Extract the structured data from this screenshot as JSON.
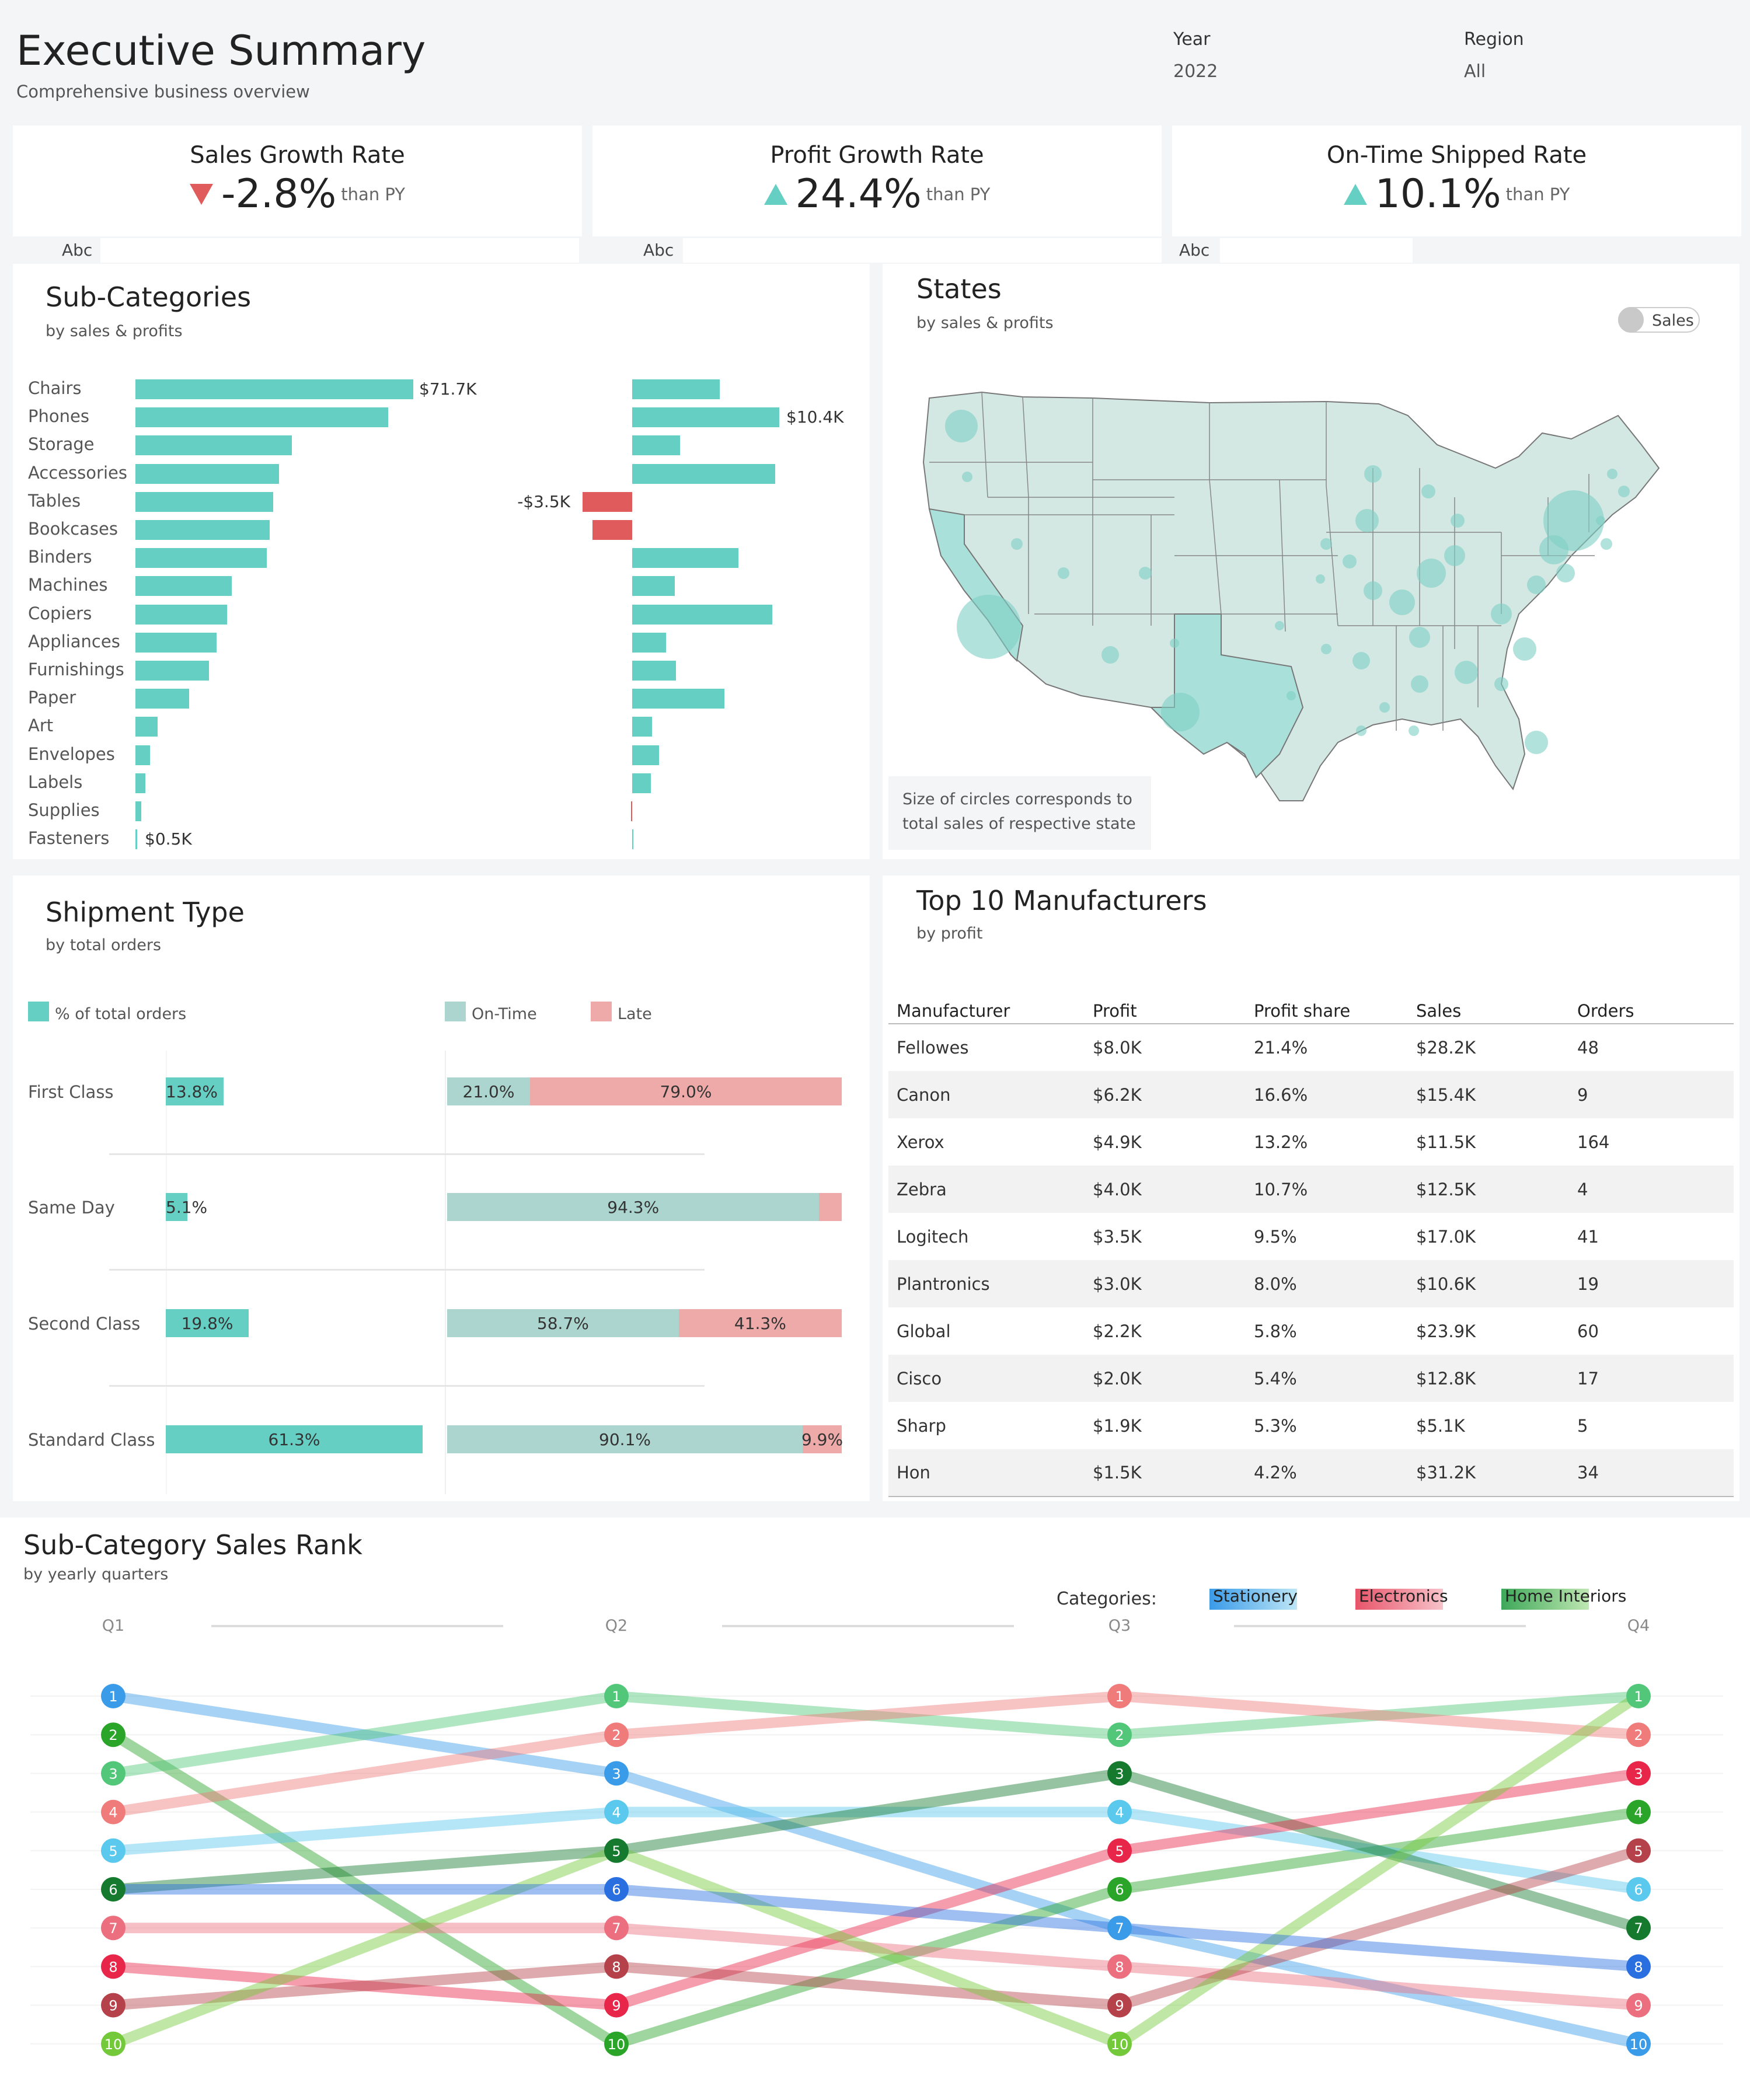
{
  "header": {
    "title": "Executive Summary",
    "subtitle": "Comprehensive business overview",
    "filters": [
      {
        "label": "Year",
        "value": "2022"
      },
      {
        "label": "Region",
        "value": "All"
      }
    ]
  },
  "kpis": [
    {
      "title": "Sales Growth Rate",
      "value": "-2.8%",
      "suffix": "than PY",
      "direction": "down",
      "placeholder": "Abc"
    },
    {
      "title": "Profit Growth Rate",
      "value": "24.4%",
      "suffix": "than PY",
      "direction": "up",
      "placeholder": "Abc"
    },
    {
      "title": "On-Time Shipped Rate",
      "value": "10.1%",
      "suffix": "than PY",
      "direction": "up",
      "placeholder": "Abc"
    }
  ],
  "colors": {
    "teal": "#66cfc4",
    "red": "#e05c5c",
    "late": "#eea9a9",
    "ontime": "#add5cf",
    "map_fill": "#d3e8e3",
    "map_highlight": "#a9e0d9"
  },
  "subcategories": {
    "title": "Sub-Categories",
    "subtitle": "by sales & profits",
    "sales_label_top": "$71.7K",
    "sales_label_bottom": "$0.5K",
    "profit_label_top": "$10.4K",
    "profit_label_neg": "-$3.5K",
    "chart_data": {
      "type": "bar",
      "categories": [
        "Chairs",
        "Phones",
        "Storage",
        "Accessories",
        "Tables",
        "Bookcases",
        "Binders",
        "Machines",
        "Copiers",
        "Appliances",
        "Furnishings",
        "Paper",
        "Art",
        "Envelopes",
        "Labels",
        "Supplies",
        "Fasteners"
      ],
      "series": [
        {
          "name": "Sales",
          "values": [
            71.7,
            65.2,
            40.4,
            37.0,
            35.6,
            34.7,
            33.9,
            24.9,
            23.7,
            21.0,
            19.0,
            13.9,
            5.7,
            3.8,
            2.6,
            1.5,
            0.5
          ]
        },
        {
          "name": "Profit",
          "values": [
            6.2,
            10.4,
            3.4,
            10.1,
            -3.5,
            -2.8,
            7.5,
            3.0,
            9.9,
            2.4,
            3.1,
            6.5,
            1.4,
            1.9,
            1.3,
            -0.1,
            0.1
          ]
        }
      ]
    }
  },
  "states": {
    "title": "States",
    "subtitle": "by sales & profits",
    "toggle_label": "Sales",
    "note_line1": "Size of circles corresponds to",
    "note_line2": "total sales of respective state"
  },
  "shipment": {
    "title": "Shipment Type",
    "subtitle": "by total orders",
    "legend_pct": "% of total orders",
    "legend_ontime": "On-Time",
    "legend_late": "Late",
    "chart_data": {
      "type": "bar",
      "categories": [
        "First Class",
        "Same Day",
        "Second Class",
        "Standard Class"
      ],
      "series": [
        {
          "name": "% of total orders",
          "values": [
            13.8,
            5.1,
            19.8,
            61.3
          ]
        },
        {
          "name": "On-Time",
          "values": [
            21.0,
            94.3,
            58.7,
            90.1
          ]
        },
        {
          "name": "Late",
          "values": [
            79.0,
            5.7,
            41.3,
            9.9
          ]
        }
      ],
      "labels": {
        "pct": [
          "13.8%",
          "5.1%",
          "19.8%",
          "61.3%"
        ],
        "ontime": [
          "21.0%",
          "94.3%",
          "58.7%",
          "90.1%"
        ],
        "late": [
          "79.0%",
          "",
          "41.3%",
          "9.9%"
        ]
      }
    }
  },
  "manufacturers": {
    "title": "Top 10 Manufacturers",
    "subtitle": "by profit",
    "columns": [
      "Manufacturer",
      "Profit",
      "Profit share",
      "Sales",
      "Orders"
    ],
    "rows": [
      [
        "Fellowes",
        "$8.0K",
        "21.4%",
        "$28.2K",
        "48"
      ],
      [
        "Canon",
        "$6.2K",
        "16.6%",
        "$15.4K",
        "9"
      ],
      [
        "Xerox",
        "$4.9K",
        "13.2%",
        "$11.5K",
        "164"
      ],
      [
        "Zebra",
        "$4.0K",
        "10.7%",
        "$12.5K",
        "4"
      ],
      [
        "Logitech",
        "$3.5K",
        "9.5%",
        "$17.0K",
        "41"
      ],
      [
        "Plantronics",
        "$3.0K",
        "8.0%",
        "$10.6K",
        "19"
      ],
      [
        "Global",
        "$2.2K",
        "5.8%",
        "$23.9K",
        "60"
      ],
      [
        "Cisco",
        "$2.0K",
        "5.4%",
        "$12.8K",
        "17"
      ],
      [
        "Sharp",
        "$1.9K",
        "5.3%",
        "$5.1K",
        "5"
      ],
      [
        "Hon",
        "$1.5K",
        "4.2%",
        "$31.2K",
        "34"
      ]
    ]
  },
  "rank": {
    "title": "Sub-Category Sales Rank",
    "subtitle": "by yearly quarters",
    "categories_label": "Categories:",
    "legend": [
      {
        "name": "Stationery",
        "color": "#4aa3e8"
      },
      {
        "name": "Electronics",
        "color": "#e8556a"
      },
      {
        "name": "Home Interiors",
        "color": "#3ea85a"
      }
    ],
    "chart_data": {
      "type": "line",
      "x": [
        "Q1",
        "Q2",
        "Q3",
        "Q4"
      ],
      "series": [
        {
          "ranks": [
            1,
            3,
            7,
            10
          ],
          "color": "#3a9be8"
        },
        {
          "ranks": [
            2,
            10,
            6,
            4
          ],
          "color": "#2aa52a"
        },
        {
          "ranks": [
            3,
            1,
            2,
            1
          ],
          "color": "#52c77a"
        },
        {
          "ranks": [
            4,
            2,
            1,
            2
          ],
          "color": "#f07b7b"
        },
        {
          "ranks": [
            5,
            4,
            4,
            6
          ],
          "color": "#5bc8ee"
        },
        {
          "ranks": [
            6,
            5,
            3,
            7
          ],
          "color": "#167a2e"
        },
        {
          "ranks": [
            7,
            7,
            8,
            9
          ],
          "color": "#ec6f7f"
        },
        {
          "ranks": [
            8,
            9,
            5,
            3
          ],
          "color": "#e8264a"
        },
        {
          "ranks": [
            9,
            8,
            9,
            5
          ],
          "color": "#b5424a"
        },
        {
          "ranks": [
            10,
            5,
            10,
            1
          ],
          "color": "#73c93a"
        },
        {
          "ranks": [
            6,
            6,
            7,
            8
          ],
          "color": "#2a6fe0"
        }
      ]
    }
  }
}
